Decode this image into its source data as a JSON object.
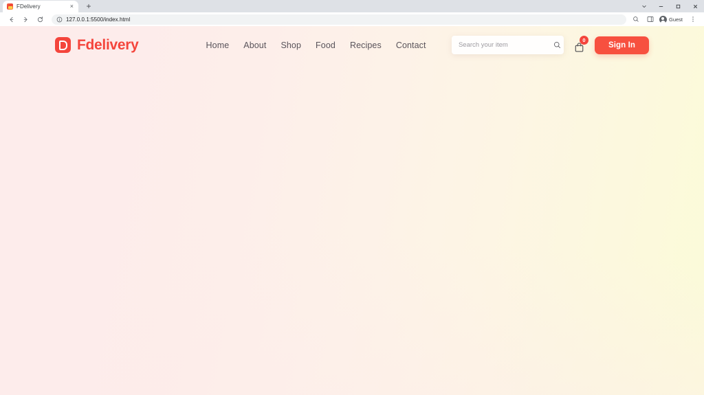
{
  "browser": {
    "tab": {
      "title": "FDelivery",
      "favicon": "fdelivery-favicon",
      "close": "×"
    },
    "new_tab_label": "+",
    "window_controls": {
      "chevron": "chevron-down",
      "minimize": "minimize",
      "maximize": "maximize",
      "close": "close"
    },
    "nav_buttons": {
      "back": "back-arrow",
      "forward": "forward-arrow",
      "reload": "reload"
    },
    "omnibox": {
      "url": "127.0.0.1:5500/index.html",
      "info_icon": "site-info-icon"
    },
    "toolbar_right": {
      "zoom_icon": "zoom-icon",
      "side_panel_icon": "side-panel-icon",
      "profile_label": "Guest",
      "menu_icon": "three-dot-menu-icon"
    }
  },
  "page": {
    "brand": {
      "mark": "D",
      "name": "Fdelivery"
    },
    "nav": [
      {
        "label": "Home"
      },
      {
        "label": "About"
      },
      {
        "label": "Shop"
      },
      {
        "label": "Food"
      },
      {
        "label": "Recipes"
      },
      {
        "label": "Contact"
      }
    ],
    "search": {
      "placeholder": "Search your item",
      "value": ""
    },
    "cart": {
      "count": "0"
    },
    "signin_label": "Sign In",
    "colors": {
      "brand_red": "#f4453c",
      "button_red": "#f7503f",
      "nav_text": "#59535a",
      "bg_left": "#fdeceb",
      "bg_right": "#fbfbd8"
    }
  }
}
